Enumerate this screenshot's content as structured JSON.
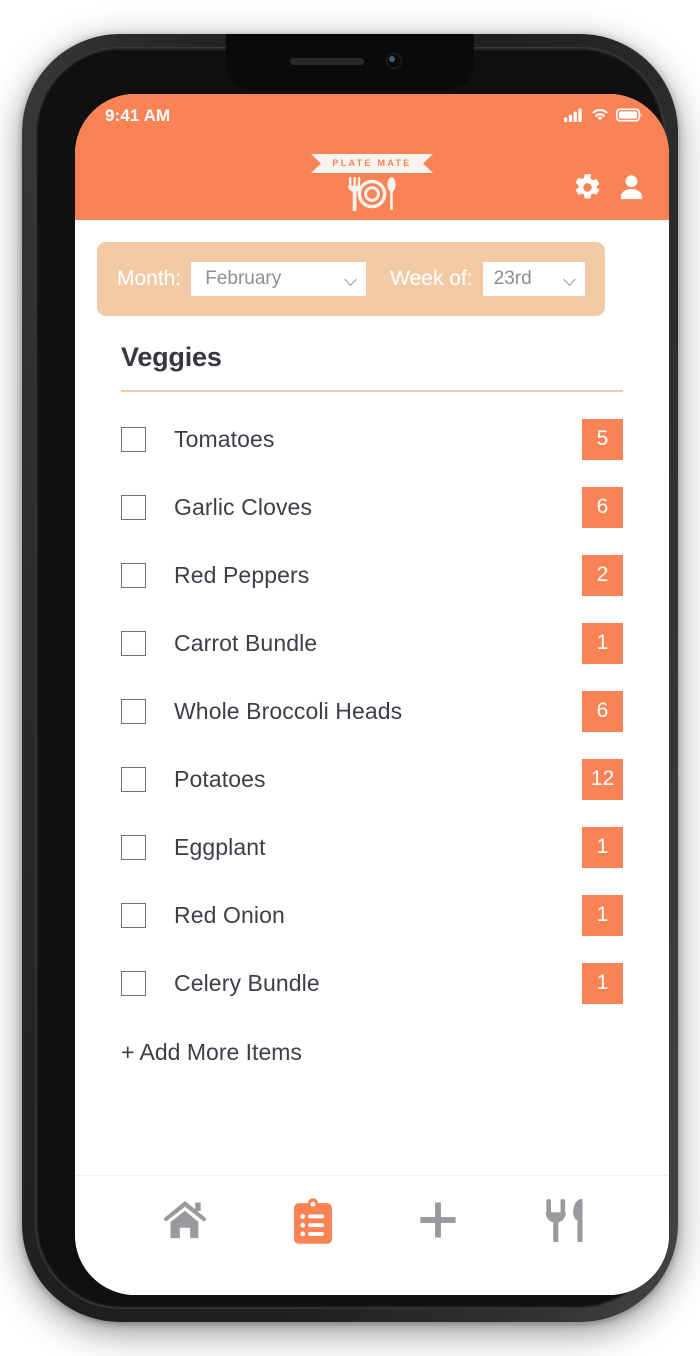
{
  "status_bar": {
    "time": "9:41 AM",
    "icons": [
      "signal-bars-icon",
      "wifi-icon",
      "battery-icon"
    ]
  },
  "header": {
    "logo_ribbon_text": "PLATE MATE",
    "logo_icon": "fork-plate-spoon-icon",
    "actions": [
      {
        "name": "settings",
        "icon": "gear-icon"
      },
      {
        "name": "profile",
        "icon": "person-icon"
      }
    ]
  },
  "selector_bar": {
    "month_label": "Month:",
    "month_value": "February",
    "week_label": "Week of:",
    "week_value": "23rd",
    "background_color": "#F2CBA6"
  },
  "list_section": {
    "title": "Veggies",
    "divider_color": "#F6C9A4",
    "add_more_label": "+ Add More Items",
    "items": [
      {
        "label": "Tomatoes",
        "qty": "5",
        "checked": false
      },
      {
        "label": "Garlic Cloves",
        "qty": "6",
        "checked": false
      },
      {
        "label": "Red Peppers",
        "qty": "2",
        "checked": false
      },
      {
        "label": "Carrot Bundle",
        "qty": "1",
        "checked": false
      },
      {
        "label": "Whole Broccoli Heads",
        "qty": "6",
        "checked": false
      },
      {
        "label": "Potatoes",
        "qty": "12",
        "checked": false
      },
      {
        "label": "Eggplant",
        "qty": "1",
        "checked": false
      },
      {
        "label": "Red Onion",
        "qty": "1",
        "checked": false
      },
      {
        "label": "Celery Bundle",
        "qty": "1",
        "checked": false
      }
    ]
  },
  "bottom_nav": {
    "items": [
      {
        "name": "home",
        "icon": "home-icon",
        "active": false
      },
      {
        "name": "list",
        "icon": "clipboard-list-icon",
        "active": true
      },
      {
        "name": "add",
        "icon": "plus-icon",
        "active": false
      },
      {
        "name": "meals",
        "icon": "fork-knife-icon",
        "active": false
      }
    ],
    "active_color": "#F98355",
    "inactive_color": "#9a9a9e"
  },
  "theme": {
    "accent": "#F98355",
    "peach": "#F2CBA6",
    "text_dark": "#3d3f47"
  }
}
